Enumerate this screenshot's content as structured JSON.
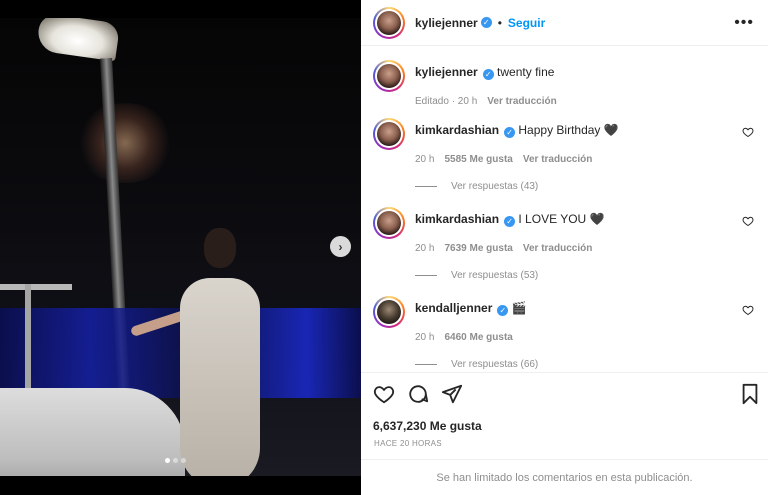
{
  "post": {
    "author": "kyliejenner",
    "follow_label": "Seguir",
    "more_label": "•••",
    "separator": "•"
  },
  "caption": {
    "username": "kyliejenner",
    "text": "twenty fine",
    "edited": "Editado · 20 h",
    "translate": "Ver traducción"
  },
  "comments": [
    {
      "username": "kimkardashian",
      "text": "Happy Birthday 🖤",
      "time": "20 h",
      "likes": "5585 Me gusta",
      "translate": "Ver traducción",
      "replies": "Ver respuestas (43)"
    },
    {
      "username": "kimkardashian",
      "text": "I LOVE YOU 🖤",
      "time": "20 h",
      "likes": "7639 Me gusta",
      "translate": "Ver traducción",
      "replies": "Ver respuestas (53)"
    },
    {
      "username": "kendalljenner",
      "text": "🎬",
      "time": "20 h",
      "likes": "6460 Me gusta",
      "translate": "",
      "replies": "Ver respuestas (66)"
    }
  ],
  "footer": {
    "likes": "6,637,230 Me gusta",
    "time_ago": "HACE 20 HORAS",
    "comments_limited": "Se han limitado los comentarios en esta publicación."
  },
  "media": {
    "next_arrow": "›",
    "dots_count": 3,
    "active_dot": 0
  },
  "icons": {
    "verified": "verified-badge-icon",
    "like": "heart-icon",
    "comment": "comment-icon",
    "share": "paper-plane-icon",
    "save": "bookmark-icon"
  },
  "colors": {
    "accent": "#0095f6",
    "verified": "#3897f0",
    "muted": "#8e8e8e"
  }
}
